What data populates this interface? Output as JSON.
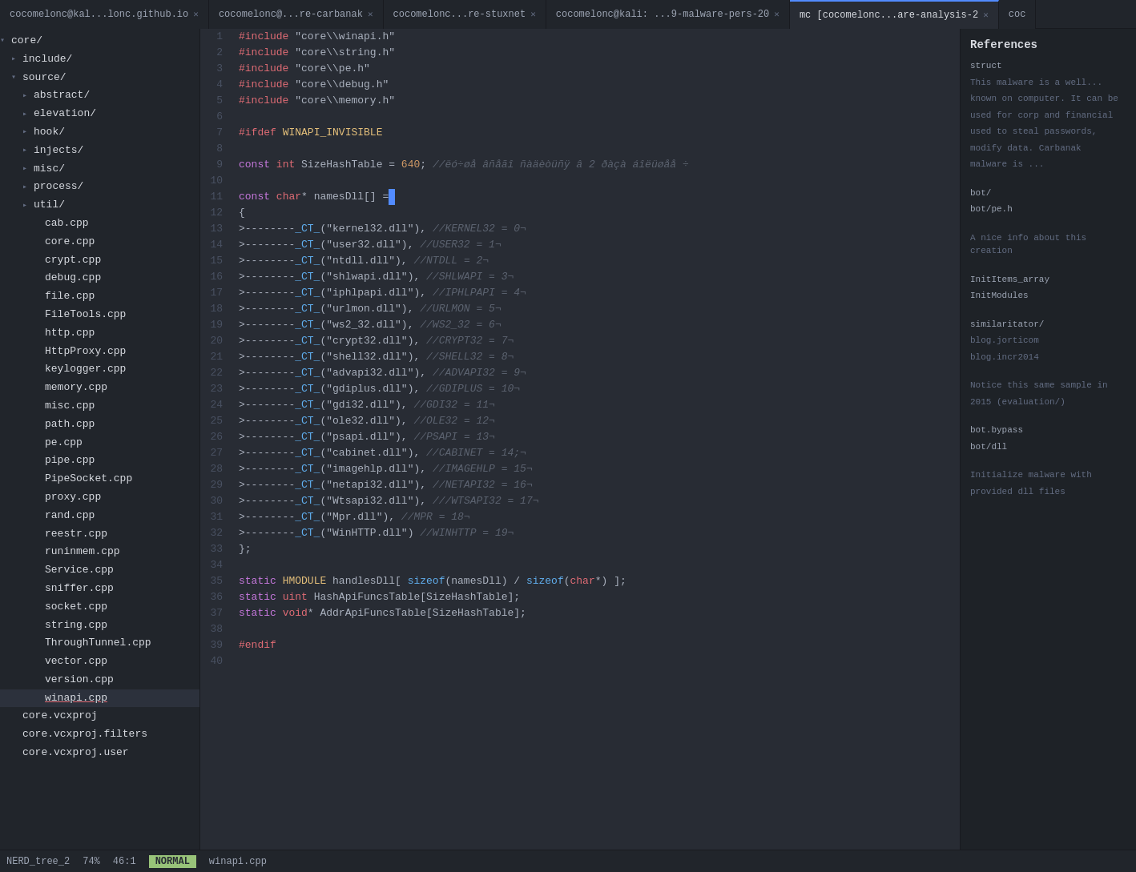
{
  "tabs": [
    {
      "label": "cocomelonc@kal...lonc.github.io",
      "active": false,
      "closeable": true
    },
    {
      "label": "cocomelonc@...re-carbanak",
      "active": false,
      "closeable": true
    },
    {
      "label": "cocomelonc...re-stuxnet",
      "active": false,
      "closeable": true
    },
    {
      "label": "cocomelonc@kali: ...9-malware-pers-20",
      "active": false,
      "closeable": true
    },
    {
      "label": "mc [cocomelonc...are-analysis-2",
      "active": true,
      "closeable": true
    },
    {
      "label": "coc",
      "active": false,
      "closeable": false
    }
  ],
  "sidebar": {
    "tree": [
      {
        "level": 0,
        "type": "folder",
        "open": true,
        "label": "core/"
      },
      {
        "level": 1,
        "type": "folder",
        "open": false,
        "label": "include/"
      },
      {
        "level": 1,
        "type": "folder",
        "open": true,
        "label": "source/"
      },
      {
        "level": 2,
        "type": "folder",
        "open": false,
        "label": "abstract/"
      },
      {
        "level": 2,
        "type": "folder",
        "open": false,
        "label": "elevation/"
      },
      {
        "level": 2,
        "type": "folder",
        "open": false,
        "label": "hook/"
      },
      {
        "level": 2,
        "type": "folder",
        "open": false,
        "label": "injects/"
      },
      {
        "level": 2,
        "type": "folder",
        "open": false,
        "label": "misc/"
      },
      {
        "level": 2,
        "type": "folder",
        "open": false,
        "label": "process/"
      },
      {
        "level": 2,
        "type": "folder",
        "open": false,
        "label": "util/"
      },
      {
        "level": 3,
        "type": "file",
        "label": "cab.cpp"
      },
      {
        "level": 3,
        "type": "file",
        "label": "core.cpp"
      },
      {
        "level": 3,
        "type": "file",
        "label": "crypt.cpp"
      },
      {
        "level": 3,
        "type": "file",
        "label": "debug.cpp"
      },
      {
        "level": 3,
        "type": "file",
        "label": "file.cpp"
      },
      {
        "level": 3,
        "type": "file",
        "label": "FileTools.cpp"
      },
      {
        "level": 3,
        "type": "file",
        "label": "http.cpp"
      },
      {
        "level": 3,
        "type": "file",
        "label": "HttpProxy.cpp"
      },
      {
        "level": 3,
        "type": "file",
        "label": "keylogger.cpp"
      },
      {
        "level": 3,
        "type": "file",
        "label": "memory.cpp"
      },
      {
        "level": 3,
        "type": "file",
        "label": "misc.cpp"
      },
      {
        "level": 3,
        "type": "file",
        "label": "path.cpp"
      },
      {
        "level": 3,
        "type": "file",
        "label": "pe.cpp"
      },
      {
        "level": 3,
        "type": "file",
        "label": "pipe.cpp"
      },
      {
        "level": 3,
        "type": "file",
        "label": "PipeSocket.cpp"
      },
      {
        "level": 3,
        "type": "file",
        "label": "proxy.cpp"
      },
      {
        "level": 3,
        "type": "file",
        "label": "rand.cpp"
      },
      {
        "level": 3,
        "type": "file",
        "label": "reestr.cpp"
      },
      {
        "level": 3,
        "type": "file",
        "label": "runinmem.cpp"
      },
      {
        "level": 3,
        "type": "file",
        "label": "Service.cpp"
      },
      {
        "level": 3,
        "type": "file",
        "label": "sniffer.cpp"
      },
      {
        "level": 3,
        "type": "file",
        "label": "socket.cpp"
      },
      {
        "level": 3,
        "type": "file",
        "label": "string.cpp"
      },
      {
        "level": 3,
        "type": "file",
        "label": "ThroughTunnel.cpp"
      },
      {
        "level": 3,
        "type": "file",
        "label": "vector.cpp"
      },
      {
        "level": 3,
        "type": "file",
        "label": "version.cpp"
      },
      {
        "level": 3,
        "type": "file",
        "selected": true,
        "label": "winapi.cpp"
      },
      {
        "level": 1,
        "type": "file",
        "label": "core.vcxproj"
      },
      {
        "level": 1,
        "type": "file",
        "label": "core.vcxproj.filters"
      },
      {
        "level": 1,
        "type": "file",
        "label": "core.vcxproj.user"
      }
    ]
  },
  "status": {
    "tree_label": "NERD_tree_2",
    "percent": "74%",
    "position": "46:1",
    "mode": "NORMAL",
    "filename": "winapi.cpp"
  },
  "code_lines": [
    {
      "num": 1,
      "raw": "#include \"core\\\\winapi.h\""
    },
    {
      "num": 2,
      "raw": "#include \"core\\\\string.h\""
    },
    {
      "num": 3,
      "raw": "#include \"core\\\\pe.h\""
    },
    {
      "num": 4,
      "raw": "#include \"core\\\\debug.h\""
    },
    {
      "num": 5,
      "raw": "#include \"core\\\\memory.h\""
    },
    {
      "num": 6,
      "raw": ""
    },
    {
      "num": 7,
      "raw": "#ifdef WINAPI_INVISIBLE"
    },
    {
      "num": 8,
      "raw": ""
    },
    {
      "num": 9,
      "raw": "const int SizeHashTable = 640; //ëó÷øå âñåãî ñàäèòüñÿ â 2 ðàçà áîëüøåå ÷"
    },
    {
      "num": 10,
      "raw": ""
    },
    {
      "num": 11,
      "raw": "const char* namesDll[] ="
    },
    {
      "num": 12,
      "raw": "{"
    },
    {
      "num": 13,
      "raw": ">--------_CT_(\"kernel32.dll\"), //KERNEL32 = 0¬"
    },
    {
      "num": 14,
      "raw": ">--------_CT_(\"user32.dll\"), //USER32 = 1¬"
    },
    {
      "num": 15,
      "raw": ">--------_CT_(\"ntdll.dll\"), //NTDLL = 2¬"
    },
    {
      "num": 16,
      "raw": ">--------_CT_(\"shlwapi.dll\"), //SHLWAPI = 3¬"
    },
    {
      "num": 17,
      "raw": ">--------_CT_(\"iphlpapi.dll\"), //IPHLPAPI = 4¬"
    },
    {
      "num": 18,
      "raw": ">--------_CT_(\"urlmon.dll\"), //URLMON = 5¬"
    },
    {
      "num": 19,
      "raw": ">--------_CT_(\"ws2_32.dll\"), //WS2_32 = 6¬"
    },
    {
      "num": 20,
      "raw": ">--------_CT_(\"crypt32.dll\"), //CRYPT32 = 7¬"
    },
    {
      "num": 21,
      "raw": ">--------_CT_(\"shell32.dll\"), //SHELL32 = 8¬"
    },
    {
      "num": 22,
      "raw": ">--------_CT_(\"advapi32.dll\"), //ADVAPI32 = 9¬"
    },
    {
      "num": 23,
      "raw": ">--------_CT_(\"gdiplus.dll\"), //GDIPLUS = 10¬"
    },
    {
      "num": 24,
      "raw": ">--------_CT_(\"gdi32.dll\"), //GDI32 = 11¬"
    },
    {
      "num": 25,
      "raw": ">--------_CT_(\"ole32.dll\"), //OLE32 = 12¬"
    },
    {
      "num": 26,
      "raw": ">--------_CT_(\"psapi.dll\"), //PSAPI = 13¬"
    },
    {
      "num": 27,
      "raw": ">--------_CT_(\"cabinet.dll\"), //CABINET = 14;¬"
    },
    {
      "num": 28,
      "raw": ">--------_CT_(\"imagehlp.dll\"), //IMAGEHLP = 15¬"
    },
    {
      "num": 29,
      "raw": ">--------_CT_(\"netapi32.dll\"), //NETAPI32 = 16¬"
    },
    {
      "num": 30,
      "raw": ">--------_CT_(\"Wtsapi32.dll\"), ///WTSAPI32 = 17¬"
    },
    {
      "num": 31,
      "raw": ">--------_CT_(\"Mpr.dll\"), //MPR = 18¬"
    },
    {
      "num": 32,
      "raw": ">--------_CT_(\"WinHTTP.dll\") //WINHTTP = 19¬"
    },
    {
      "num": 33,
      "raw": "};"
    },
    {
      "num": 34,
      "raw": ""
    },
    {
      "num": 35,
      "raw": "static HMODULE handlesDll[ sizeof(namesDll) / sizeof(char*) ];"
    },
    {
      "num": 36,
      "raw": "static uint HashApiFuncsTable[SizeHashTable];"
    },
    {
      "num": 37,
      "raw": "static void* AddrApiFuncsTable[SizeHashTable];"
    },
    {
      "num": 38,
      "raw": ""
    },
    {
      "num": 39,
      "raw": "#endif"
    },
    {
      "num": 40,
      "raw": ""
    }
  ]
}
